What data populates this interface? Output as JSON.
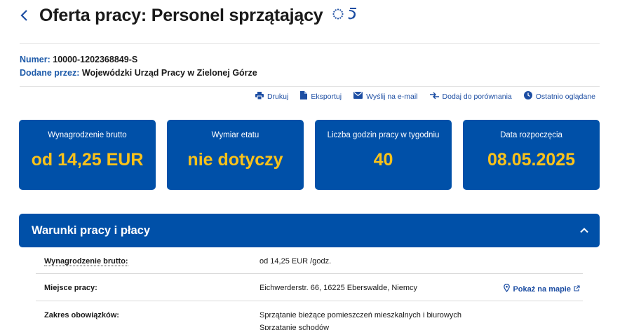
{
  "header": {
    "title": "Oferta pracy: Personel sprzątający"
  },
  "meta": {
    "number_label": "Numer:",
    "number_value": "10000-1202368849-S",
    "added_label": "Dodane przez:",
    "added_value": "Wojewódzki Urząd Pracy w Zielonej Górze"
  },
  "actions": [
    {
      "label": "Drukuj",
      "icon": "print-icon"
    },
    {
      "label": "Eksportuj",
      "icon": "file-icon"
    },
    {
      "label": "Wyślij na e-mail",
      "icon": "mail-icon"
    },
    {
      "label": "Dodaj do porównania",
      "icon": "compare-icon"
    },
    {
      "label": "Ostatnio oglądane",
      "icon": "clock-icon"
    }
  ],
  "cards": [
    {
      "label": "Wynagrodzenie brutto",
      "value": "od 14,25 EUR"
    },
    {
      "label": "Wymiar etatu",
      "value": "nie dotyczy"
    },
    {
      "label": "Liczba godzin pracy w tygodniu",
      "value": "40"
    },
    {
      "label": "Data rozpoczęcia",
      "value": "08.05.2025"
    }
  ],
  "panel": {
    "title": "Warunki pracy i płacy"
  },
  "rows": [
    {
      "key": "Wynagrodzenie brutto:",
      "value": "od 14,25 EUR /godz."
    },
    {
      "key": "Miejsce pracy:",
      "value": "Eichwerderstr. 66, 16225 Eberswalde, Niemcy",
      "link": "Pokaż na mapie"
    },
    {
      "key": "Zakres obowiązków:",
      "value": "Sprzątanie bieżące pomieszczeń mieszkalnych i biurowych",
      "value2": "Sprzątanie schodów"
    }
  ],
  "colors": {
    "primary": "#0050a8",
    "accent": "#f9c21a",
    "link": "#1d4ea3"
  }
}
